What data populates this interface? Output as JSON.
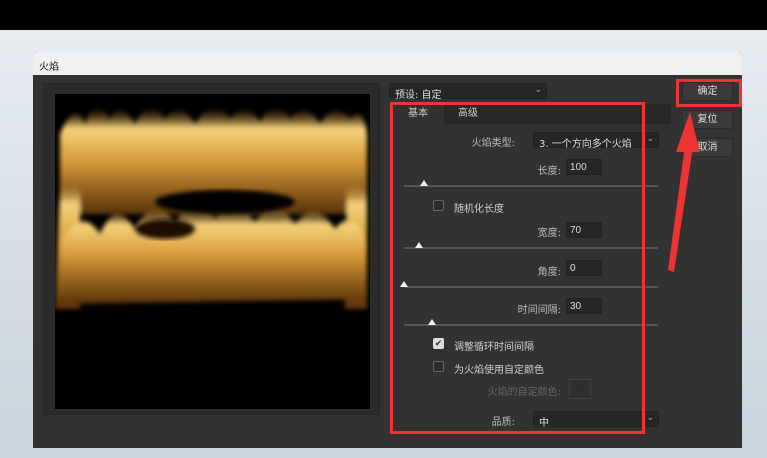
{
  "dialog": {
    "title": "火焰"
  },
  "preset": {
    "label": "预设: 自定"
  },
  "buttons": {
    "ok": "确定",
    "reset": "复位",
    "cancel": "取消"
  },
  "tabs": [
    {
      "label": "基本",
      "active": true
    },
    {
      "label": "高级",
      "active": false
    }
  ],
  "flame_type": {
    "label": "火焰类型:",
    "value": "3. 一个方向多个火焰"
  },
  "length": {
    "label": "长度:",
    "value": "100",
    "slider_fraction": 0.08
  },
  "randomize_length": {
    "label": "随机化长度",
    "checked": false
  },
  "width": {
    "label": "宽度:",
    "value": "70",
    "slider_fraction": 0.06
  },
  "angle": {
    "label": "角度:",
    "value": "0",
    "slider_fraction": 0.0
  },
  "interval": {
    "label": "时间间隔:",
    "value": "30",
    "slider_fraction": 0.11
  },
  "adjust_loop": {
    "label": "调整循环时间间隔",
    "checked": true
  },
  "custom_color": {
    "label": "为火焰使用自定颜色",
    "checked": false
  },
  "custom_color_swatch": {
    "label": "火焰的自定颜色:"
  },
  "quality": {
    "label": "品质:",
    "value": "中"
  },
  "colors": {
    "annotation": "#ee3333",
    "dialog_bg": "#323232"
  }
}
